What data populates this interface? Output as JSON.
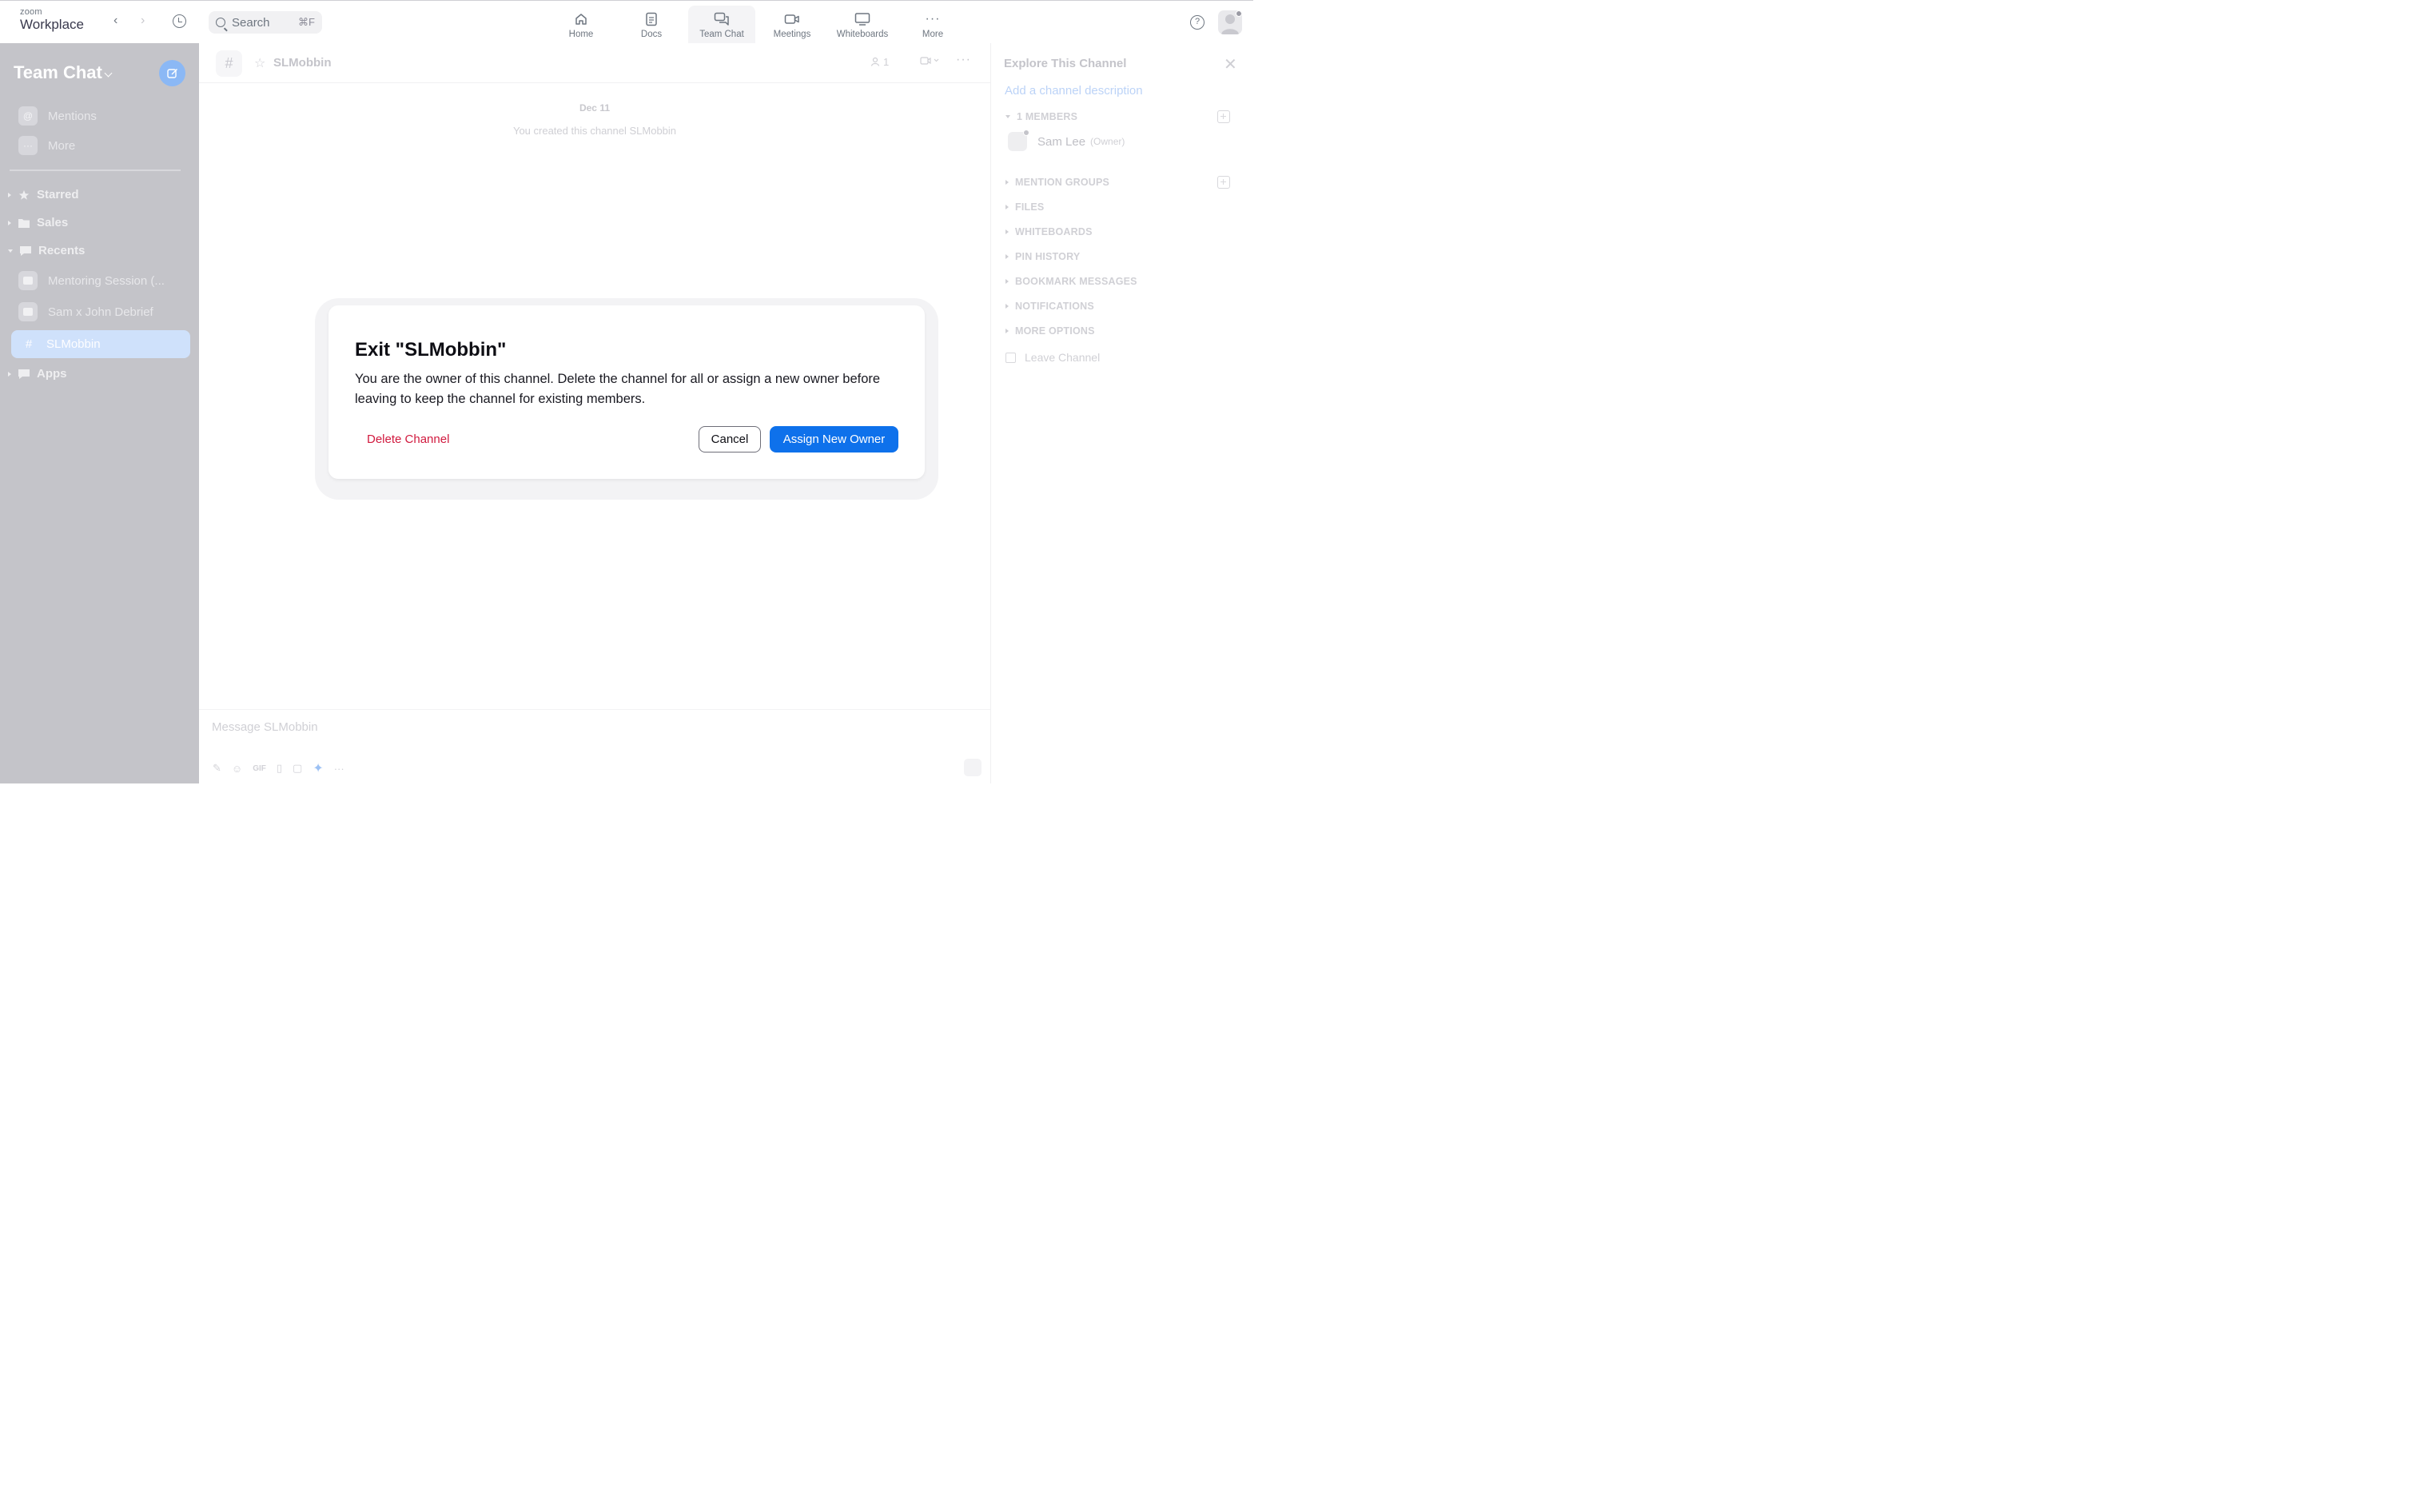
{
  "app": {
    "logo_small": "zoom",
    "logo_big": "Workplace",
    "search_placeholder": "Search",
    "search_shortcut": "⌘F"
  },
  "tabs": [
    {
      "label": "Home",
      "icon": "home-icon"
    },
    {
      "label": "Docs",
      "icon": "docs-icon"
    },
    {
      "label": "Team Chat",
      "icon": "chat-icon",
      "active": true
    },
    {
      "label": "Meetings",
      "icon": "video-icon"
    },
    {
      "label": "Whiteboards",
      "icon": "whiteboard-icon"
    },
    {
      "label": "More",
      "icon": "more-icon"
    }
  ],
  "sidebar": {
    "title": "Team Chat",
    "quick_items": [
      {
        "label": "Mentions",
        "icon": "@"
      },
      {
        "label": "More",
        "icon": "···"
      }
    ],
    "sections": [
      {
        "label": "Starred",
        "expanded": false
      },
      {
        "label": "Sales",
        "expanded": false
      },
      {
        "label": "Recents",
        "expanded": true
      }
    ],
    "recents": [
      {
        "label": "Mentoring Session (..."
      },
      {
        "label": "Sam x John Debrief"
      }
    ],
    "active_channel": {
      "hash": "#",
      "label": "SLMobbin"
    },
    "apps_label": "Apps"
  },
  "channel": {
    "hash": "#",
    "name": "SLMobbin",
    "member_count": "1",
    "date": "Dec 11",
    "system_message": "You created this channel SLMobbin",
    "composer_placeholder": "Message SLMobbin",
    "composer_gif": "GIF"
  },
  "right_panel": {
    "title": "Explore This Channel",
    "description_link": "Add a channel description",
    "members_header": "1 MEMBERS",
    "member": {
      "name": "Sam Lee",
      "role": "(Owner)"
    },
    "sections": [
      "MENTION GROUPS",
      "FILES",
      "WHITEBOARDS",
      "PIN HISTORY",
      "BOOKMARK MESSAGES",
      "NOTIFICATIONS",
      "MORE OPTIONS"
    ],
    "leave_label": "Leave Channel"
  },
  "modal": {
    "title": "Exit \"SLMobbin\"",
    "body": "You are the owner of this channel. Delete the channel for all or assign a new owner before leaving to keep the channel for existing members.",
    "delete_label": "Delete Channel",
    "cancel_label": "Cancel",
    "assign_label": "Assign New Owner",
    "colors": {
      "primary": "#0e71eb",
      "danger": "#d1193e"
    }
  }
}
